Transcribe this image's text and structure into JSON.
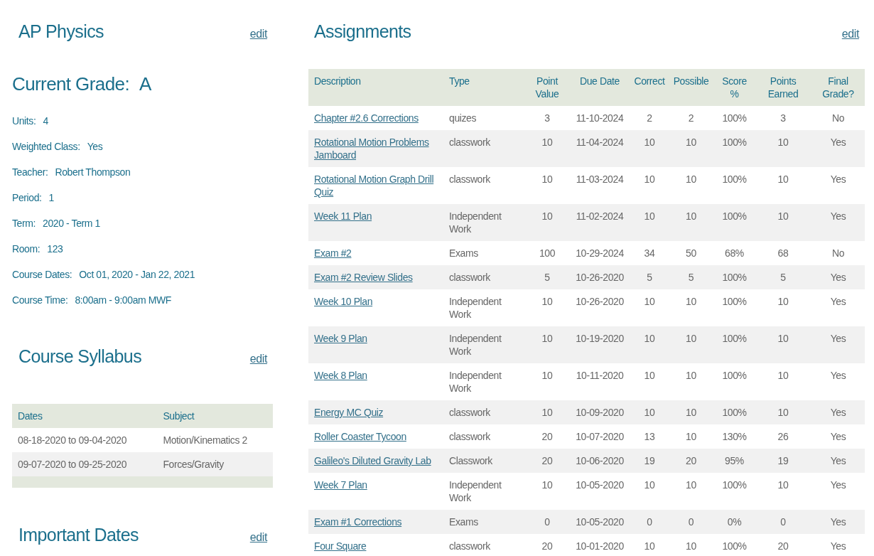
{
  "course": {
    "title": "AP Physics",
    "edit_link": "edit",
    "grade_label": "Current Grade:",
    "grade": "A",
    "details": [
      {
        "label": "Units:",
        "value": "4"
      },
      {
        "label": "Weighted Class:",
        "value": "Yes"
      },
      {
        "label": "Teacher:",
        "value": "Robert Thompson"
      },
      {
        "label": "Period:",
        "value": "1"
      },
      {
        "label": "Term:",
        "value": "2020 - Term 1"
      },
      {
        "label": "Room:",
        "value": "123"
      },
      {
        "label": "Course Dates:",
        "value": "Oct 01, 2020 - Jan 22, 2021"
      },
      {
        "label": "Course Time:",
        "value": "8:00am - 9:00am MWF"
      }
    ]
  },
  "syllabus": {
    "title": "Course Syllabus",
    "edit_link": "edit",
    "columns": [
      "Dates",
      "Subject"
    ],
    "rows": [
      [
        "08-18-2020 to 09-04-2020",
        "Motion/Kinematics 2"
      ],
      [
        "09-07-2020 to 09-25-2020",
        "Forces/Gravity"
      ]
    ]
  },
  "important_dates": {
    "title": "Important Dates",
    "edit_link": "edit"
  },
  "assignments": {
    "title": "Assignments",
    "edit_link": "edit",
    "columns": [
      "Description",
      "Type",
      "Point Value",
      "Due Date",
      "Correct",
      "Possible",
      "Score %",
      "Points Earned",
      "Final Grade?"
    ],
    "rows": [
      [
        "Chapter #2.6 Corrections",
        "quizes",
        "3",
        "11-10-2024",
        "2",
        "2",
        "100%",
        "3",
        "No"
      ],
      [
        "Rotational Motion Problems Jamboard",
        "classwork",
        "10",
        "11-04-2024",
        "10",
        "10",
        "100%",
        "10",
        "Yes"
      ],
      [
        "Rotational Motion Graph Drill Quiz",
        "classwork",
        "10",
        "11-03-2024",
        "10",
        "10",
        "100%",
        "10",
        "Yes"
      ],
      [
        "Week 11 Plan",
        "Independent Work",
        "10",
        "11-02-2024",
        "10",
        "10",
        "100%",
        "10",
        "Yes"
      ],
      [
        "Exam #2",
        "Exams",
        "100",
        "10-29-2024",
        "34",
        "50",
        "68%",
        "68",
        "No"
      ],
      [
        "Exam #2 Review Slides",
        "classwork",
        "5",
        "10-26-2020",
        "5",
        "5",
        "100%",
        "5",
        "Yes"
      ],
      [
        "Week 10 Plan",
        "Independent Work",
        "10",
        "10-26-2020",
        "10",
        "10",
        "100%",
        "10",
        "Yes"
      ],
      [
        "Week 9 Plan",
        "Independent Work",
        "10",
        "10-19-2020",
        "10",
        "10",
        "100%",
        "10",
        "Yes"
      ],
      [
        "Week 8 Plan",
        "Independent Work",
        "10",
        "10-11-2020",
        "10",
        "10",
        "100%",
        "10",
        "Yes"
      ],
      [
        "Energy MC Quiz",
        "classwork",
        "10",
        "10-09-2020",
        "10",
        "10",
        "100%",
        "10",
        "Yes"
      ],
      [
        "Roller Coaster Tycoon",
        "classwork",
        "20",
        "10-07-2020",
        "13",
        "10",
        "130%",
        "26",
        "Yes"
      ],
      [
        "Galileo's Diluted Gravity Lab",
        "Classwork",
        "20",
        "10-06-2020",
        "19",
        "20",
        "95%",
        "19",
        "Yes"
      ],
      [
        "Week 7 Plan",
        "Independent Work",
        "10",
        "10-05-2020",
        "10",
        "10",
        "100%",
        "10",
        "Yes"
      ],
      [
        "Exam #1 Corrections",
        "Exams",
        "0",
        "10-05-2020",
        "0",
        "0",
        "0%",
        "0",
        "Yes"
      ],
      [
        "Four Square",
        "classwork",
        "20",
        "10-01-2020",
        "10",
        "10",
        "100%",
        "20",
        "Yes"
      ]
    ]
  }
}
